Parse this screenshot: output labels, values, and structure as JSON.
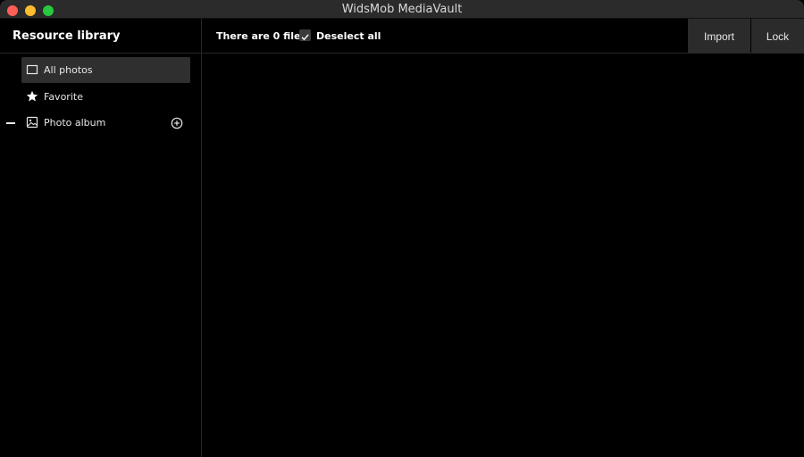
{
  "window": {
    "title": "WidsMob MediaVault",
    "traffic_colors": {
      "close": "#ff5f57",
      "minimize": "#febc2e",
      "zoom": "#28c840"
    }
  },
  "sidebar": {
    "title": "Resource library",
    "items": [
      {
        "label": "All photos",
        "icon": "square-outline-icon",
        "active": true
      },
      {
        "label": "Favorite",
        "icon": "star-icon",
        "active": false
      },
      {
        "label": "Photo album",
        "icon": "image-icon",
        "active": false
      }
    ],
    "album_group_collapse_icon": "minus-icon",
    "add_album_icon": "plus-circle-icon"
  },
  "toolbar": {
    "file_count": "There are 0 files",
    "deselect_label": "Deselect all",
    "deselect_checked": true,
    "import_label": "Import",
    "lock_label": "Lock"
  },
  "theme": {
    "background": "#000000",
    "sidebar_active": "#2f2f2f",
    "button_bg": "#2b2b2b",
    "text": "#ffffff"
  }
}
